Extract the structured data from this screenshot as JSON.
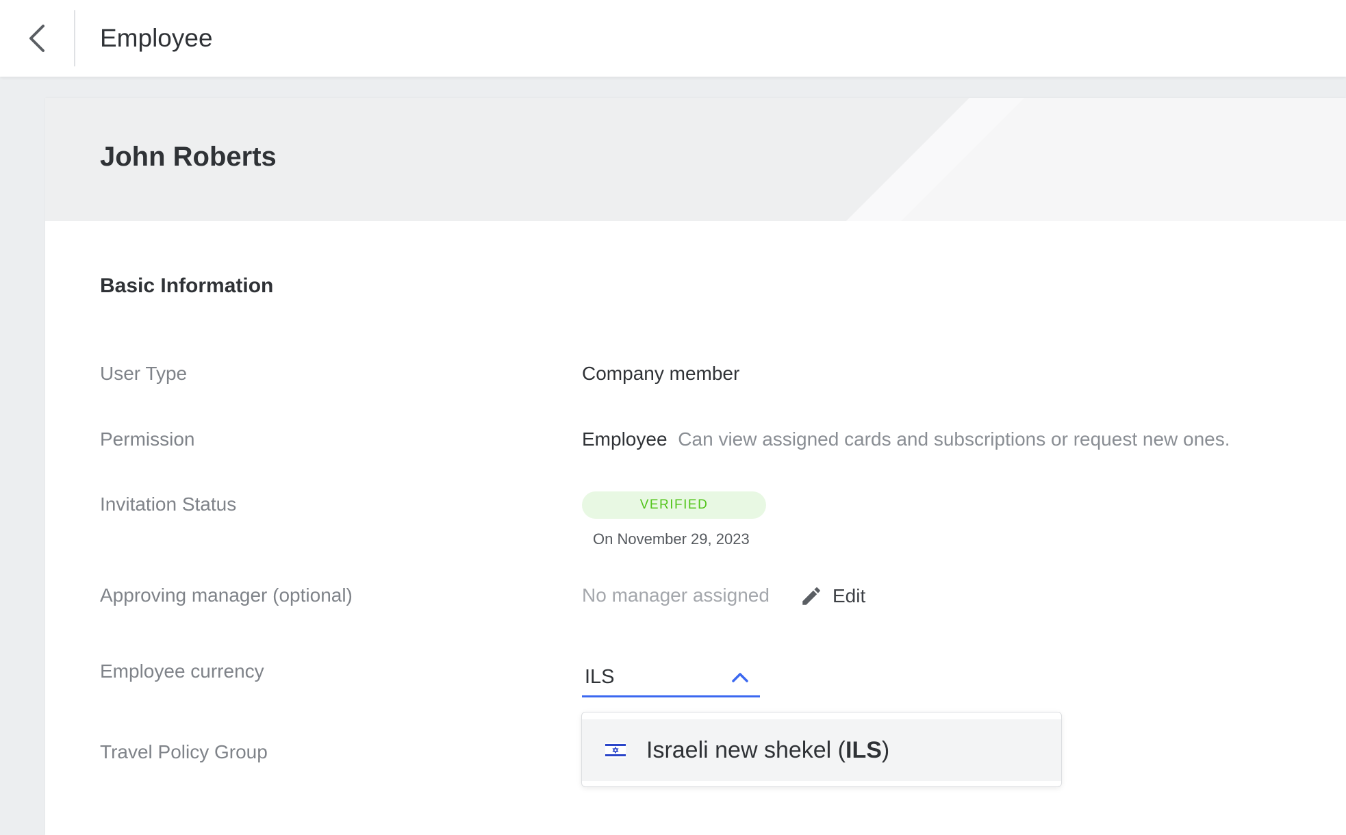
{
  "header": {
    "title": "Employee",
    "back_icon": "chevron-left-icon"
  },
  "employee": {
    "name": "John Roberts"
  },
  "basic_info": {
    "section_title": "Basic Information",
    "user_type_label": "User Type",
    "user_type_value": "Company member",
    "permission_label": "Permission",
    "permission_role": "Employee",
    "permission_desc": "Can view assigned cards and subscriptions or request new ones.",
    "invitation_label": "Invitation Status",
    "invitation_badge": "VERIFIED",
    "invitation_date": "On November 29, 2023",
    "manager_label": "Approving manager (optional)",
    "manager_value": "No manager assigned",
    "edit_label": "Edit",
    "edit_icon": "pencil-icon",
    "currency_label": "Employee currency",
    "currency_value": "ILS",
    "currency_chevron_icon": "chevron-up-icon",
    "travel_policy_label": "Travel Policy Group"
  },
  "currency_dropdown": {
    "option_name": "Israeli new shekel (",
    "option_code": "ILS",
    "option_close": ")",
    "option_flag_icon": "israel-flag-icon"
  },
  "colors": {
    "accent": "#3b68f0",
    "badge_bg": "#e8f8e3",
    "badge_text": "#52c41a",
    "label_text": "#7f8389",
    "page_bg": "#eceef0"
  }
}
